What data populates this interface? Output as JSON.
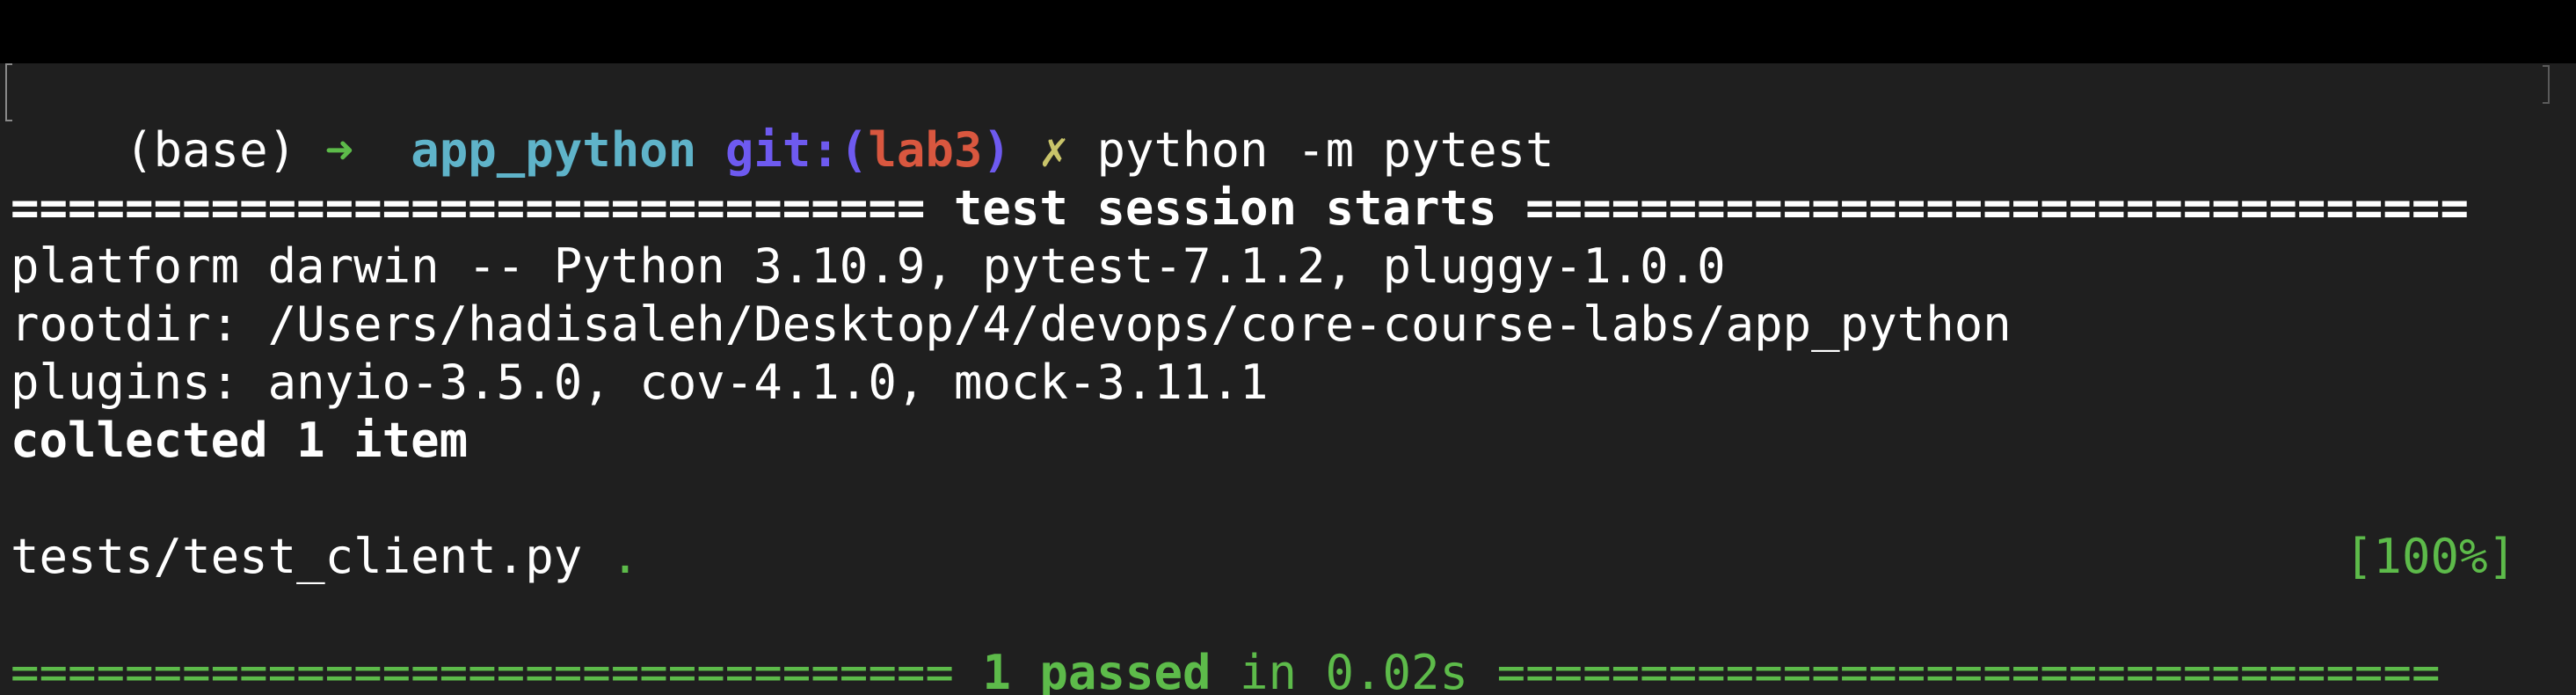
{
  "terminal": {
    "prompt": {
      "env": "(base)",
      "arrow": "➜",
      "dir": "app_python",
      "git_label": "git:",
      "git_open": "(",
      "git_branch": "lab3",
      "git_close": ")",
      "dirty_mark": "✗",
      "command": "python -m pytest"
    },
    "session_header": {
      "left_rule": "================================",
      "text": "test session starts",
      "right_rule": "================================="
    },
    "platform_line": "platform darwin -- Python 3.10.9, pytest-7.1.2, pluggy-1.0.0",
    "rootdir_line": "rootdir: /Users/hadisaleh/Desktop/4/devops/core-course-labs/app_python",
    "plugins_line": "plugins: anyio-3.5.0, cov-4.1.0, mock-3.11.1",
    "collected_line": "collected 1 item",
    "test_file": "tests/test_client.py",
    "test_result_dot": ".",
    "test_progress": "[100%]",
    "summary": {
      "left_rule": "=================================",
      "passed_text": "1 passed",
      "time_text": "in 0.02s",
      "right_rule": "================================="
    },
    "colors": {
      "background": "#1f1f1f",
      "green": "#5dbb4a",
      "cyan": "#5fb3c9",
      "purple": "#6e5af0",
      "red": "#d9573f",
      "yellow": "#c9c46a"
    }
  }
}
